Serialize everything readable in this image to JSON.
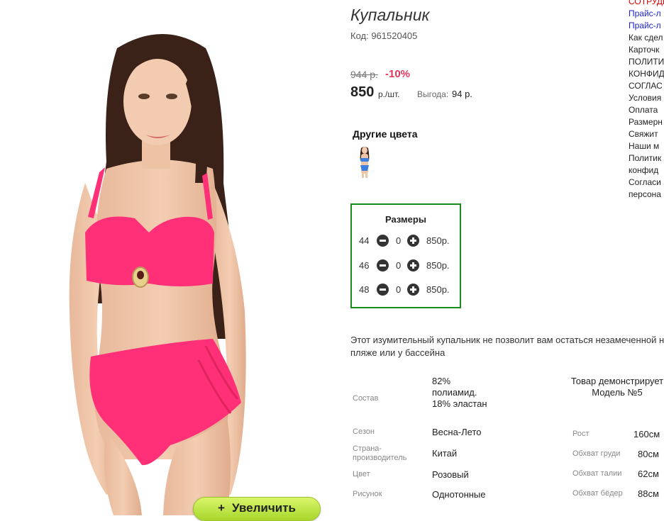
{
  "product": {
    "title": "Купальник",
    "code": "Код: 961520405",
    "old_price": "944 р.",
    "discount": "-10%",
    "price": "850",
    "price_unit": "р./шт.",
    "saving_label": "Выгода:",
    "saving_value": "94 р.",
    "other_colors_label": "Другие цвета",
    "zoom_button": "Увеличить",
    "zoom_icon": "+",
    "description": "Этот изумительный купальник не позволит вам остаться незамеченной на пляже или у бассейна"
  },
  "sizes": {
    "title": "Размеры",
    "rows": [
      {
        "size": "44",
        "qty": "0",
        "price": "850р."
      },
      {
        "size": "46",
        "qty": "0",
        "price": "850р."
      },
      {
        "size": "48",
        "qty": "0",
        "price": "850р."
      }
    ]
  },
  "specs": [
    {
      "label": "Состав",
      "value": "82% полиамид. 18% эластан"
    },
    {
      "label": "Сезон",
      "value": "Весна-Лето"
    },
    {
      "label": "Страна-производитель",
      "value": "Китай"
    },
    {
      "label": "Цвет",
      "value": "Розовый"
    },
    {
      "label": "Рисунок",
      "value": "Однотонные"
    }
  ],
  "model": {
    "title": "Товар демонстрирует Модель №5",
    "measurements": [
      {
        "label": "Рост",
        "value": "160см"
      },
      {
        "label": "Обхват груди",
        "value": "80см"
      },
      {
        "label": "Обхват талии",
        "value": "62см"
      },
      {
        "label": "Обхват бёдер",
        "value": "88см"
      }
    ]
  },
  "menu": [
    {
      "label": "СОТРУДН",
      "color": "#dd0000"
    },
    {
      "label": "Прайс-л",
      "color": "#1b1fd6"
    },
    {
      "label": "Прайс-л",
      "color": "#1b1fd6"
    },
    {
      "label": "Как сдел"
    },
    {
      "label": "Карточк"
    },
    {
      "label": "ПОЛИТИ"
    },
    {
      "label": "КОНФИД"
    },
    {
      "label": "СОГЛАС"
    },
    {
      "label": "Условия"
    },
    {
      "label": "Оплата"
    },
    {
      "label": "Размерн"
    },
    {
      "label": "Свяжит"
    },
    {
      "label": "Наши м"
    },
    {
      "label": "Политик"
    },
    {
      "label": "конфид"
    },
    {
      "label": "Согласи"
    },
    {
      "label": "персона"
    }
  ],
  "colors": {
    "swimsuit": "#ff2f78",
    "accent_green": "#1a8a1a",
    "discount_red": "#e0375c"
  }
}
